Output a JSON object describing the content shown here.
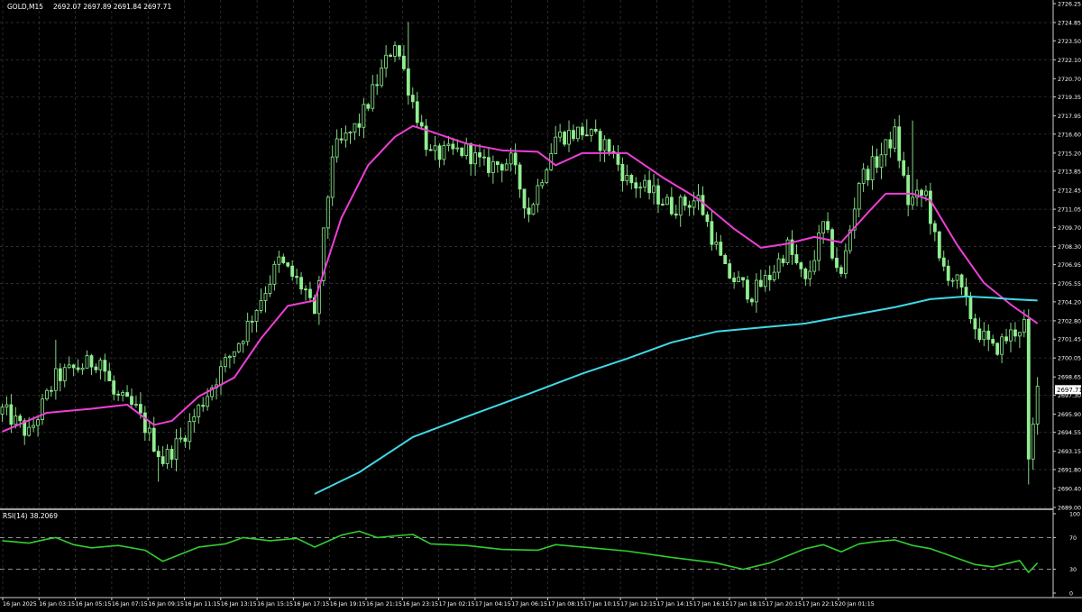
{
  "header": {
    "symbol_label": "GOLD,M15",
    "ohlc_text": "2692.07 2697.89 2691.84 2697.71"
  },
  "rsi_header": {
    "label": "RSI(14) 38.2069"
  },
  "colors": {
    "background": "#000000",
    "grid": "#3a3a3a",
    "text": "#ffffff",
    "candle": "#90ee90",
    "ma_fast": "#ee3fd6",
    "ma_slow": "#40d8e6",
    "rsi_line": "#32cd32",
    "price_tag_bg": "#ffffff",
    "price_tag_fg": "#000000"
  },
  "chart_data": [
    {
      "type": "candlestick",
      "title": "GOLD,M15",
      "ylim": [
        2689.0,
        2726.25
      ],
      "y_ticks": [
        "2726.25",
        "2724.85",
        "2723.50",
        "2722.10",
        "2720.70",
        "2719.35",
        "2717.95",
        "2716.60",
        "2715.20",
        "2713.85",
        "2712.45",
        "2711.05",
        "2709.70",
        "2708.30",
        "2706.95",
        "2705.55",
        "2704.20",
        "2702.80",
        "2701.45",
        "2700.05",
        "2698.65",
        "2697.30",
        "2695.90",
        "2694.55",
        "2693.15",
        "2691.80",
        "2690.40",
        "2689.00"
      ],
      "current_price": "2697.71",
      "x_ticks": [
        "16 Jan 2025",
        "16 Jan 03:15",
        "16 Jan 05:15",
        "16 Jan 07:15",
        "16 Jan 09:15",
        "16 Jan 11:15",
        "16 Jan 13:15",
        "16 Jan 15:15",
        "16 Jan 17:15",
        "16 Jan 19:15",
        "16 Jan 21:15",
        "16 Jan 23:15",
        "17 Jan 02:15",
        "17 Jan 04:15",
        "17 Jan 06:15",
        "17 Jan 08:15",
        "17 Jan 10:15",
        "17 Jan 12:15",
        "17 Jan 14:15",
        "17 Jan 16:15",
        "17 Jan 18:15",
        "17 Jan 20:15",
        "17 Jan 22:15",
        "20 Jan 01:15"
      ],
      "close_path": [
        [
          0,
          2696.2
        ],
        [
          6,
          2694.4
        ],
        [
          12,
          2698.6
        ],
        [
          16,
          2699.2
        ],
        [
          22,
          2700.0
        ],
        [
          25,
          2697.3
        ],
        [
          30,
          2696.2
        ],
        [
          36,
          2692.5
        ],
        [
          40,
          2694.0
        ],
        [
          48,
          2698.6
        ],
        [
          54,
          2701.8
        ],
        [
          62,
          2707.2
        ],
        [
          68,
          2705.0
        ],
        [
          70,
          2702.8
        ],
        [
          74,
          2715.2
        ],
        [
          80,
          2717.4
        ],
        [
          88,
          2723.5
        ],
        [
          92,
          2719.0
        ],
        [
          96,
          2715.0
        ],
        [
          104,
          2715.4
        ],
        [
          108,
          2714.2
        ],
        [
          114,
          2714.6
        ],
        [
          118,
          2710.8
        ],
        [
          124,
          2716.4
        ],
        [
          130,
          2716.8
        ],
        [
          136,
          2715.6
        ],
        [
          140,
          2713.2
        ],
        [
          146,
          2712.2
        ],
        [
          150,
          2711.2
        ],
        [
          156,
          2711.8
        ],
        [
          162,
          2706.4
        ],
        [
          168,
          2704.8
        ],
        [
          172,
          2706.1
        ],
        [
          176,
          2708.3
        ],
        [
          180,
          2705.5
        ],
        [
          184,
          2709.8
        ],
        [
          188,
          2706.0
        ],
        [
          192,
          2713.2
        ],
        [
          196,
          2714.6
        ],
        [
          200,
          2716.6
        ],
        [
          203,
          2711.6
        ],
        [
          207,
          2712.2
        ],
        [
          210,
          2707.1
        ],
        [
          214,
          2705.6
        ],
        [
          218,
          2702.4
        ],
        [
          222,
          2700.6
        ],
        [
          226,
          2701.8
        ],
        [
          229,
          2702.6
        ],
        [
          230,
          2692.0
        ],
        [
          232,
          2697.7
        ]
      ],
      "spikes": [
        [
          12,
          2701.4
        ],
        [
          35,
          2690.9
        ],
        [
          91,
          2724.9
        ],
        [
          122,
          2713.1
        ],
        [
          131,
          2717.7
        ],
        [
          204,
          2717.6
        ],
        [
          230,
          2690.7
        ]
      ],
      "ma_fast": [
        [
          0,
          2694.6
        ],
        [
          10,
          2696.0
        ],
        [
          20,
          2696.3
        ],
        [
          28,
          2696.6
        ],
        [
          34,
          2695.1
        ],
        [
          38,
          2695.4
        ],
        [
          44,
          2697.2
        ],
        [
          52,
          2698.6
        ],
        [
          58,
          2701.5
        ],
        [
          64,
          2703.9
        ],
        [
          70,
          2704.3
        ],
        [
          76,
          2710.4
        ],
        [
          82,
          2714.3
        ],
        [
          88,
          2716.4
        ],
        [
          92,
          2717.2
        ],
        [
          96,
          2716.8
        ],
        [
          104,
          2715.9
        ],
        [
          112,
          2715.4
        ],
        [
          120,
          2715.3
        ],
        [
          124,
          2714.3
        ],
        [
          130,
          2715.2
        ],
        [
          140,
          2715.2
        ],
        [
          148,
          2713.4
        ],
        [
          156,
          2711.8
        ],
        [
          164,
          2709.6
        ],
        [
          170,
          2708.2
        ],
        [
          176,
          2708.5
        ],
        [
          182,
          2709.0
        ],
        [
          188,
          2708.6
        ],
        [
          194,
          2710.8
        ],
        [
          198,
          2712.2
        ],
        [
          204,
          2712.2
        ],
        [
          208,
          2711.7
        ],
        [
          214,
          2708.4
        ],
        [
          220,
          2705.6
        ],
        [
          226,
          2704.0
        ],
        [
          232,
          2702.6
        ]
      ],
      "ma_slow": [
        [
          70,
          2690.0
        ],
        [
          80,
          2691.6
        ],
        [
          92,
          2694.2
        ],
        [
          104,
          2695.7
        ],
        [
          118,
          2697.4
        ],
        [
          130,
          2698.9
        ],
        [
          140,
          2700.0
        ],
        [
          150,
          2701.2
        ],
        [
          160,
          2702.0
        ],
        [
          170,
          2702.3
        ],
        [
          180,
          2702.6
        ],
        [
          190,
          2703.2
        ],
        [
          200,
          2703.8
        ],
        [
          208,
          2704.4
        ],
        [
          216,
          2704.6
        ],
        [
          222,
          2704.5
        ],
        [
          226,
          2704.4
        ],
        [
          232,
          2704.3
        ]
      ]
    },
    {
      "type": "line",
      "title": "RSI(14) 38.2069",
      "ylim": [
        0,
        100
      ],
      "y_ticks": [
        "100",
        "70",
        "30",
        "0"
      ],
      "levels": [
        30,
        70
      ],
      "series": [
        {
          "values": [
            [
              0,
              66
            ],
            [
              6,
              63
            ],
            [
              10,
              68
            ],
            [
              12,
              70
            ],
            [
              16,
              61
            ],
            [
              20,
              57
            ],
            [
              26,
              60
            ],
            [
              32,
              54
            ],
            [
              36,
              40
            ],
            [
              40,
              49
            ],
            [
              44,
              58
            ],
            [
              50,
              62
            ],
            [
              54,
              70
            ],
            [
              60,
              66
            ],
            [
              66,
              69
            ],
            [
              70,
              58
            ],
            [
              76,
              73
            ],
            [
              80,
              78
            ],
            [
              84,
              70
            ],
            [
              88,
              72
            ],
            [
              92,
              74
            ],
            [
              96,
              62
            ],
            [
              104,
              60
            ],
            [
              112,
              55
            ],
            [
              120,
              54
            ],
            [
              124,
              61
            ],
            [
              130,
              58
            ],
            [
              140,
              53
            ],
            [
              150,
              45
            ],
            [
              160,
              38
            ],
            [
              166,
              30
            ],
            [
              172,
              38
            ],
            [
              180,
              56
            ],
            [
              184,
              61
            ],
            [
              188,
              52
            ],
            [
              192,
              62
            ],
            [
              196,
              65
            ],
            [
              200,
              67
            ],
            [
              204,
              60
            ],
            [
              208,
              56
            ],
            [
              212,
              48
            ],
            [
              218,
              36
            ],
            [
              222,
              33
            ],
            [
              228,
              41
            ],
            [
              230,
              26
            ],
            [
              232,
              38
            ]
          ]
        }
      ]
    }
  ]
}
